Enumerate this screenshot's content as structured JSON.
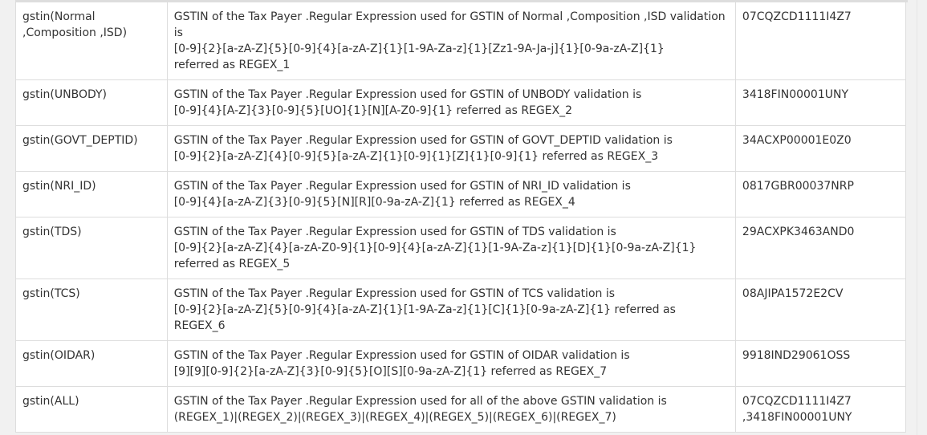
{
  "table": {
    "rows": [
      {
        "name": "gstin(Normal ,Composition ,ISD)",
        "desc": [
          "GSTIN of the Tax Payer .Regular Expression used for GSTIN of Normal ,Composition ,ISD validation  is",
          "[0-9]{2}[a-zA-Z]{5}[0-9]{4}[a-zA-Z]{1}[1-9A-Za-z]{1}[Zz1-9A-Ja-j]{1}[0-9a-zA-Z]{1}",
          "referred as REGEX_1"
        ],
        "sample": "07CQZCD1111I4Z7"
      },
      {
        "name": "gstin(UNBODY)",
        "desc": [
          "GSTIN of the Tax Payer .Regular Expression used for GSTIN of UNBODY validation  is",
          "[0-9]{4}[A-Z]{3}[0-9]{5}[UO]{1}[N][A-Z0-9]{1} referred as REGEX_2"
        ],
        "sample": "3418FIN00001UNY"
      },
      {
        "name": "gstin(GOVT_DEPTID)",
        "desc": [
          "GSTIN of the Tax Payer .Regular Expression used for GSTIN of GOVT_DEPTID validation  is",
          "[0-9]{2}[a-zA-Z]{4}[0-9]{5}[a-zA-Z]{1}[0-9]{1}[Z]{1}[0-9]{1} referred as REGEX_3"
        ],
        "sample": "34ACXP00001E0Z0"
      },
      {
        "name": "gstin(NRI_ID)",
        "desc": [
          "GSTIN of the Tax Payer .Regular Expression used for GSTIN of NRI_ID validation  is",
          "[0-9]{4}[a-zA-Z]{3}[0-9]{5}[N][R][0-9a-zA-Z]{1} referred as REGEX_4"
        ],
        "sample": "0817GBR00037NRP"
      },
      {
        "name": "gstin(TDS)",
        "desc": [
          "GSTIN of the Tax Payer .Regular Expression used for GSTIN of TDS validation  is",
          "[0-9]{2}[a-zA-Z]{4}[a-zA-Z0-9]{1}[0-9]{4}[a-zA-Z]{1}[1-9A-Za-z]{1}[D]{1}[0-9a-zA-Z]{1}",
          "referred as REGEX_5"
        ],
        "sample": "29ACXPK3463AND0"
      },
      {
        "name": "gstin(TCS)",
        "desc": [
          "GSTIN of the Tax Payer .Regular Expression used for GSTIN of TCS validation  is",
          "[0-9]{2}[a-zA-Z]{5}[0-9]{4}[a-zA-Z]{1}[1-9A-Za-z]{1}[C]{1}[0-9a-zA-Z]{1} referred as",
          "REGEX_6"
        ],
        "sample": "08AJIPA1572E2CV"
      },
      {
        "name": "gstin(OIDAR)",
        "desc": [
          "GSTIN of the Tax Payer .Regular Expression used for GSTIN of OIDAR validation  is",
          "[9][9][0-9]{2}[a-zA-Z]{3}[0-9]{5}[O][S][0-9a-zA-Z]{1} referred as REGEX_7"
        ],
        "sample": "9918IND29061OSS"
      },
      {
        "name": "gstin(ALL)",
        "desc": [
          "GSTIN of the Tax Payer .Regular Expression used for all of the above GSTIN validation  is",
          "(REGEX_1)|(REGEX_2)|(REGEX_3)|(REGEX_4)|(REGEX_5)|(REGEX_6)|(REGEX_7)"
        ],
        "sample": "07CQZCD1111I4Z7\n,3418FIN00001UNY"
      }
    ]
  }
}
